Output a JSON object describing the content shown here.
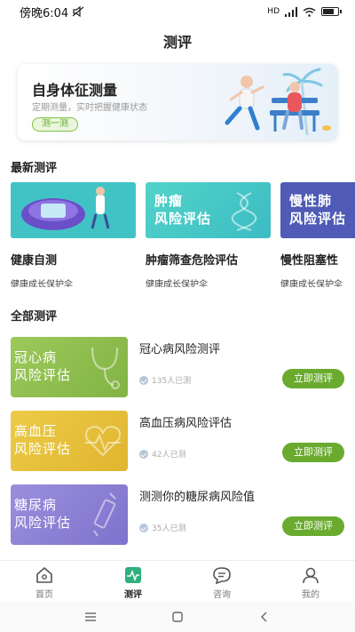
{
  "status": {
    "time": "傍晚6:04",
    "network": "HD"
  },
  "page": {
    "title": "测评"
  },
  "hero": {
    "title": "自身体征测量",
    "subtitle": "定期测量，实时把握健康状态",
    "button": "测一测"
  },
  "latest": {
    "section_title": "最新测评",
    "cards": [
      {
        "name": "健康自测",
        "desc": "健康成长保护伞",
        "thumb_line1": "",
        "thumb_line2": "",
        "color": "#3fc0c4"
      },
      {
        "name": "肿瘤筛查危险评估",
        "desc": "健康成长保护伞",
        "thumb_line1": "肿瘤",
        "thumb_line2": "风险评估",
        "color": "#4dcfc8"
      },
      {
        "name": "慢性阻塞性",
        "desc": "健康成长保护伞",
        "thumb_line1": "慢性肺",
        "thumb_line2": "风险评估",
        "color": "#4f5bb6"
      }
    ]
  },
  "all": {
    "section_title": "全部测评",
    "items": [
      {
        "title": "冠心病风险测评",
        "count": "135人已测",
        "button": "立即测评",
        "thumb_line1": "冠心病",
        "thumb_line2": "风险评估",
        "color": "#8fbe4f"
      },
      {
        "title": "高血压病风险评估",
        "count": "42人已测",
        "button": "立即测评",
        "thumb_line1": "高血压",
        "thumb_line2": "风险评估",
        "color": "#e8c33c"
      },
      {
        "title": "测测你的糖尿病风险值",
        "count": "35人已测",
        "button": "立即测评",
        "thumb_line1": "糖尿病",
        "thumb_line2": "风险评估",
        "color": "#8b7fd4"
      }
    ]
  },
  "tabbar": [
    {
      "label": "首页",
      "icon": "home-icon",
      "active": false
    },
    {
      "label": "测评",
      "icon": "assessment-icon",
      "active": true
    },
    {
      "label": "咨询",
      "icon": "chat-icon",
      "active": false
    },
    {
      "label": "我的",
      "icon": "user-icon",
      "active": false
    }
  ],
  "colors": {
    "accent": "#6aab2f",
    "active_tab": "#2fb07a"
  }
}
